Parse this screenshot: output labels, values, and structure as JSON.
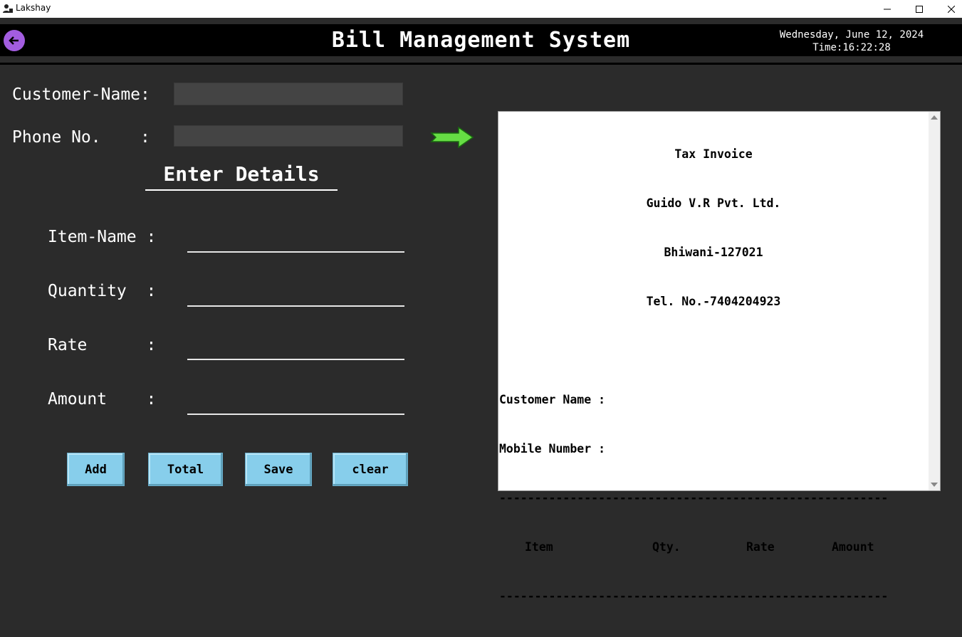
{
  "window": {
    "title": "Lakshay"
  },
  "header": {
    "title": "Bill Management System",
    "date": "Wednesday, June 12, 2024",
    "time": "Time:16:22:28"
  },
  "customer": {
    "name_label": "Customer-Name:",
    "name_value": "",
    "phone_label": "Phone No.    :",
    "phone_value": ""
  },
  "details": {
    "title": "Enter Details",
    "item_label": "Item-Name :",
    "quantity_label": "Quantity  :",
    "rate_label": "Rate      :",
    "amount_label": "Amount    :"
  },
  "buttons": {
    "add": "Add",
    "total": "Total",
    "save": "Save",
    "clear": "clear"
  },
  "receipt": {
    "heading": "Tax Invoice",
    "company": "Guido V.R Pvt. Ltd.",
    "address": "Bhiwani-127021",
    "phone": "Tel. No.-7404204923",
    "customer_name_label": "Customer Name :",
    "mobile_label": "Mobile Number :",
    "divider": "-------------------------------------------------------",
    "columns": [
      "Item",
      "Qty.",
      "Rate",
      "Amount"
    ]
  },
  "colors": {
    "back_button": "#a35de0",
    "arrow": "#66dd44",
    "button_bg": "#87ceeb",
    "bg": "#2b2b2b"
  },
  "icons": {
    "back": "arrow-left-icon",
    "pointer": "right-arrow-icon",
    "app": "user-icon"
  }
}
